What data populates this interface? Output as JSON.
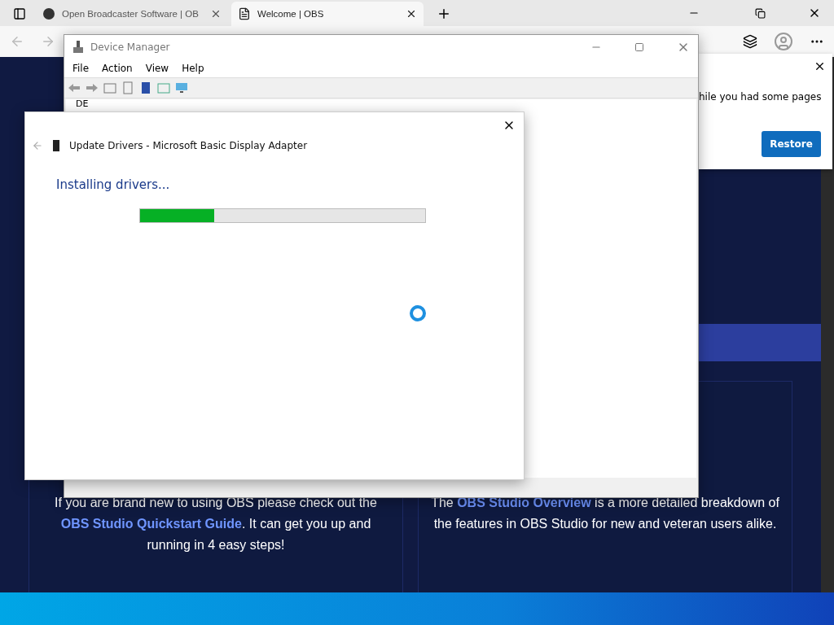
{
  "browser": {
    "tabs": [
      {
        "label": "Open Broadcaster Software | OB",
        "selected": false
      },
      {
        "label": "Welcome | OBS",
        "selected": true
      }
    ]
  },
  "restore_popup": {
    "message": "hile you had some pages",
    "button": "Restore"
  },
  "page": {
    "cards": [
      {
        "parts": [
          {
            "kind": "text",
            "text": "If you are brand new to using OBS please check out the "
          },
          {
            "kind": "link",
            "text": "OBS Studio Quickstart Guide"
          },
          {
            "kind": "text",
            "text": ". It can get you up and running in 4 easy steps!"
          }
        ]
      },
      {
        "parts": [
          {
            "kind": "text",
            "text": "The "
          },
          {
            "kind": "link",
            "text": "OBS Studio Overview"
          },
          {
            "kind": "text",
            "text": " is a more detailed breakdown of the features in OBS Studio for new and veteran users alike."
          }
        ]
      }
    ]
  },
  "device_manager": {
    "title": "Device Manager",
    "menu": [
      "File",
      "Action",
      "View",
      "Help"
    ],
    "tree_item": "DE"
  },
  "update_dialog": {
    "title": "Update Drivers - Microsoft Basic Display Adapter",
    "status": "Installing drivers...",
    "progress": {
      "level": 0.26
    }
  }
}
